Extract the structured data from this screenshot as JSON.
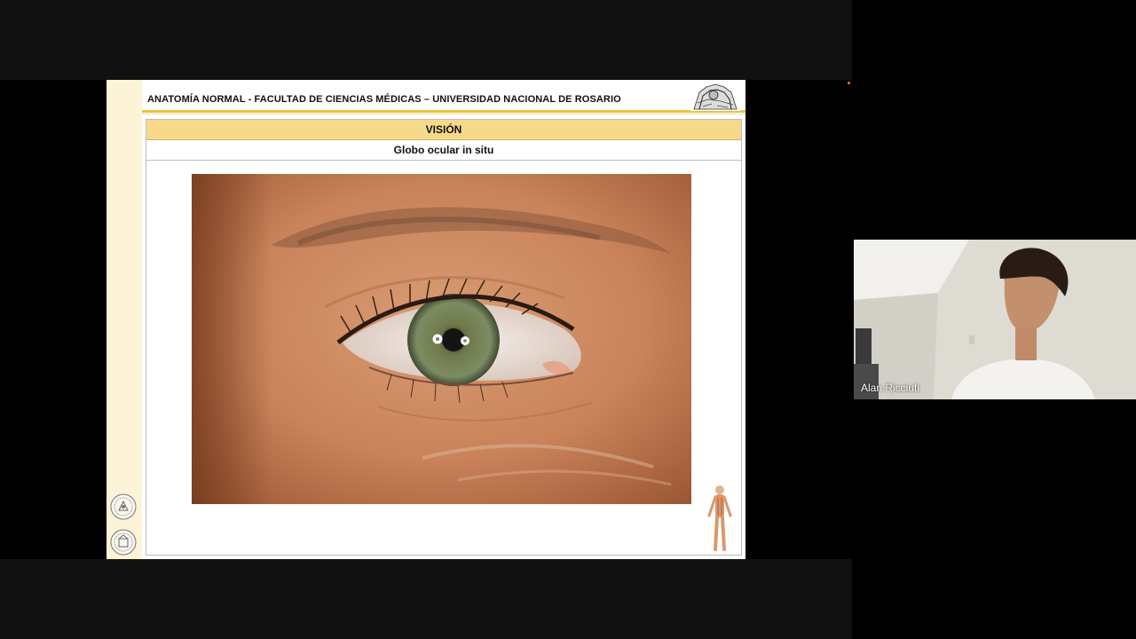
{
  "meeting": {
    "participant_name": "Alan Ricciuti"
  },
  "slide": {
    "header_text": "ANATOMÍA NORMAL - FACULTAD  DE CIENCIAS MÉDICAS – UNIVERSIDAD NACIONAL DE ROSARIO",
    "section_title": "VISIÓN",
    "subtitle": "Globo ocular in situ"
  },
  "colors": {
    "header_rule": "#e8c53a",
    "section_bar": "#f7d98a",
    "side_strip": "#fdf4d8"
  },
  "icons": [
    "university-logo-icon",
    "seal-icon",
    "human-figure-icon",
    "recording-indicator-icon"
  ]
}
